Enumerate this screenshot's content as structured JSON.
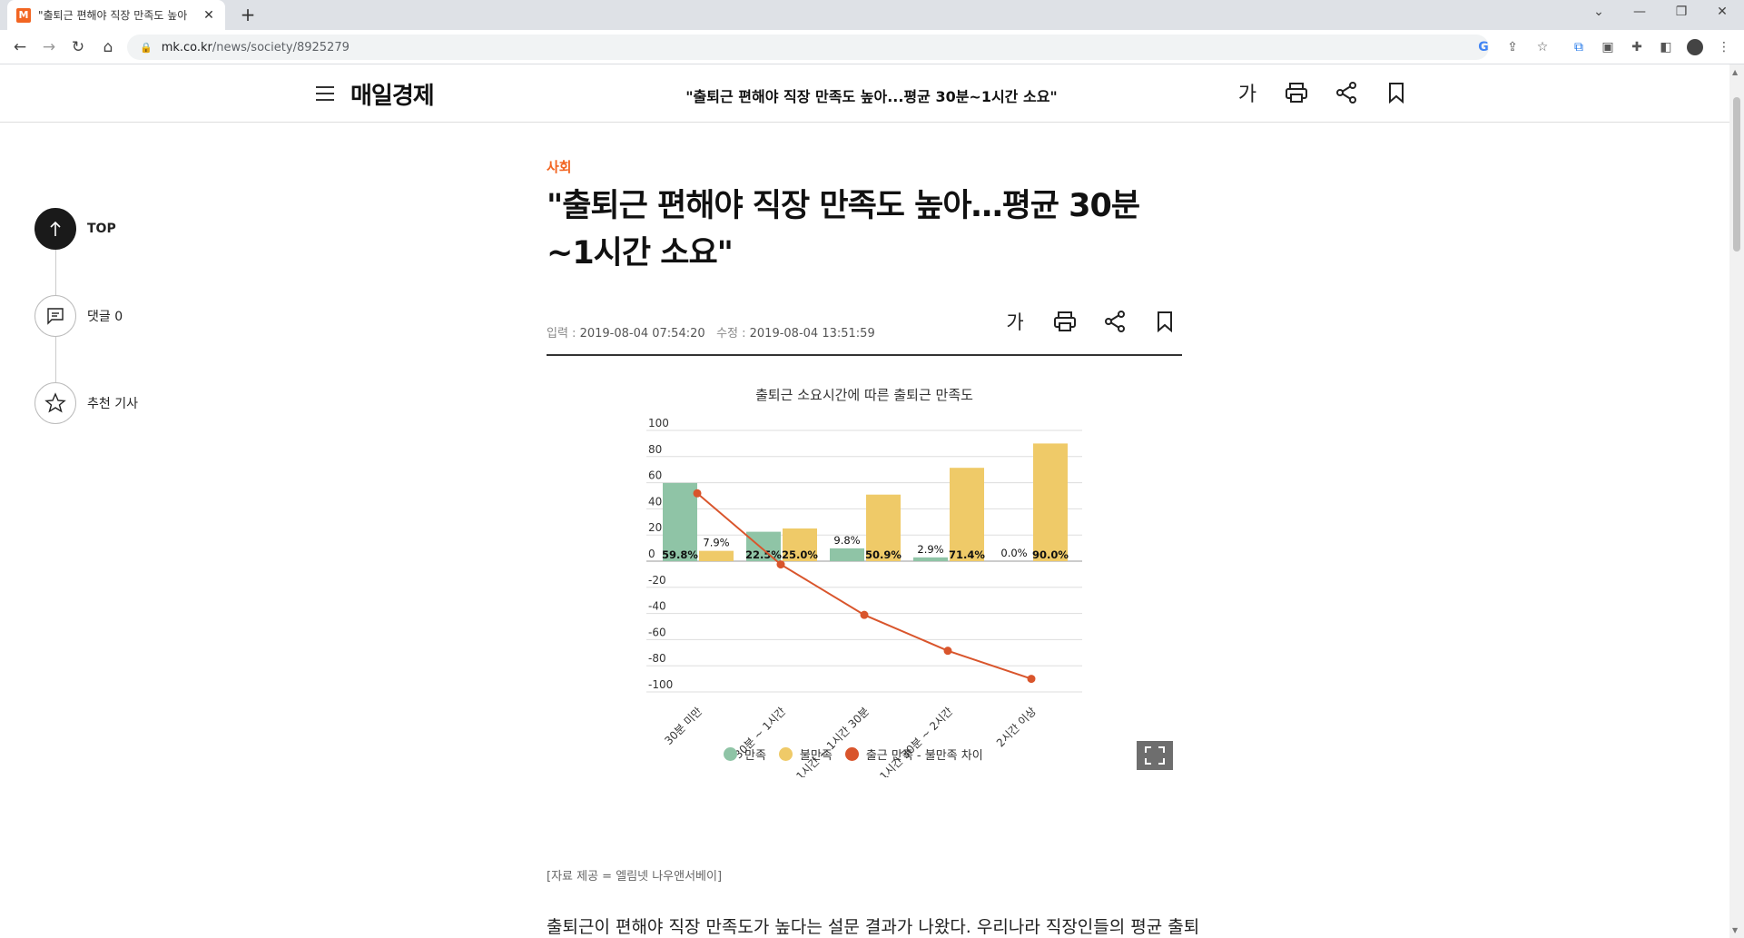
{
  "browser": {
    "tab": {
      "favicon": "M",
      "title": "\"출퇴근 편해야 직장 만족도 높아"
    },
    "url": {
      "host": "mk.co.kr",
      "path": "/news/society/8925279"
    }
  },
  "header": {
    "logo": "매일경제",
    "title": "\"출퇴근 편해야 직장 만족도 높아...평균 30분~1시간 소요\"",
    "font_size_label": "가"
  },
  "side_nav": {
    "top_label": "TOP",
    "comments_label": "댓글 0",
    "recommend_label": "추천 기사"
  },
  "article": {
    "category": "사회",
    "headline_line1": "\"출퇴근 편해야 직장 만족도 높아…평균 30분",
    "headline_line2": "~1시간 소요\"",
    "published_label": "입력 : ",
    "published": "2019-08-04 07:54:20",
    "modified_label": "수정 : ",
    "modified": "2019-08-04 13:51:59",
    "font_size_label": "가",
    "source": "[자료 제공 = 엘림넷 나우앤서베이]",
    "body_start": "출퇴근이 편해야 직장 만족도가 높다는 설문 결과가 나왔다. 우리나라 직장인들의 평균 출퇴근 시"
  },
  "chart_data": {
    "type": "bar",
    "title": "출퇴근 소요시간에 따른 출퇴근 만족도",
    "categories": [
      "30분 미만",
      "30분 ~ 1시간",
      "1시간 ~ 1시간 30분",
      "1시간 30분 ~ 2시간",
      "2시간 이상"
    ],
    "series": [
      {
        "name": "만족",
        "type": "bar",
        "color": "#8fc4a6",
        "values": [
          59.8,
          22.5,
          9.8,
          2.9,
          0.0
        ],
        "labels": [
          "59.8%",
          "22.5%",
          "9.8%",
          "2.9%",
          "0.0%"
        ]
      },
      {
        "name": "불만족",
        "type": "bar",
        "color": "#efca68",
        "values": [
          7.9,
          25.0,
          50.9,
          71.4,
          90.0
        ],
        "labels": [
          "7.9%",
          "25.0%",
          "50.9%",
          "71.4%",
          "90.0%"
        ]
      },
      {
        "name": "출근 만족 - 불만족 차이",
        "type": "line",
        "color": "#d9552c",
        "values": [
          51.9,
          -2.5,
          -41.1,
          -68.5,
          -90.0
        ]
      }
    ],
    "yticks": [
      "100",
      "80",
      "60",
      "40",
      "20",
      "0",
      "-20",
      "-40",
      "-60",
      "-80",
      "-100"
    ],
    "ylim": [
      -100,
      100
    ],
    "grid": true,
    "legend": "bottom"
  }
}
